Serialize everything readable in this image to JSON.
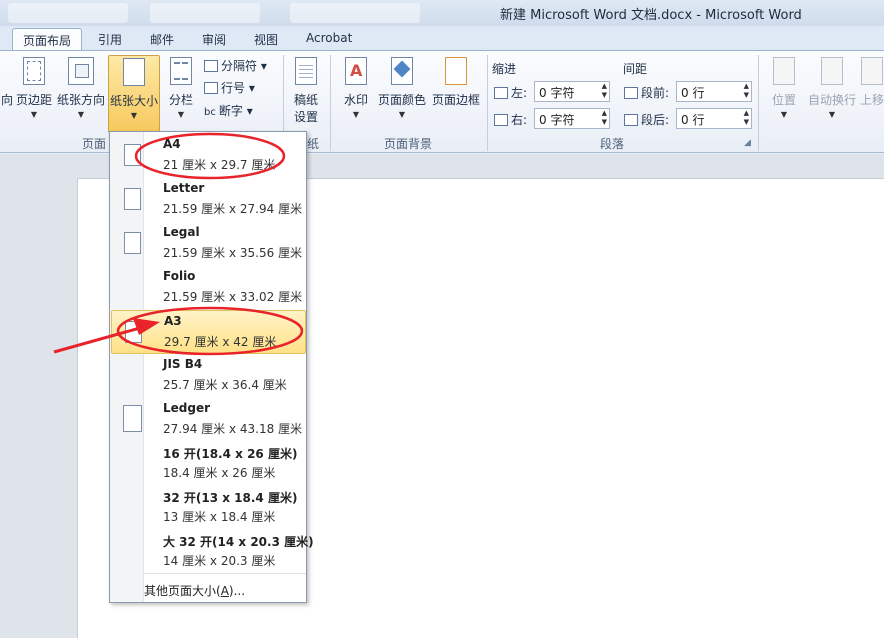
{
  "window": {
    "title": "新建 Microsoft Word 文档.docx - Microsoft Word"
  },
  "tabs": [
    {
      "label": "页面布局",
      "active": true
    },
    {
      "label": "引用"
    },
    {
      "label": "邮件"
    },
    {
      "label": "审阅"
    },
    {
      "label": "视图"
    },
    {
      "label": "Acrobat"
    }
  ],
  "ribbon": {
    "page_setup": {
      "cut_label": "向",
      "margins": "页边距",
      "orientation": "纸张方向",
      "size": "纸张大小",
      "columns": "分栏",
      "breaks": "分隔符",
      "line_numbers": "行号",
      "hyphenation": "断字",
      "group_label": "页面"
    },
    "draft": {
      "line1": "稿纸",
      "line2": "设置",
      "group_cut": "纸"
    },
    "background": {
      "watermark": "水印",
      "page_color": "页面颜色",
      "page_borders": "页面边框",
      "group_label": "页面背景"
    },
    "paragraph": {
      "indent_title": "缩进",
      "spacing_title": "间距",
      "left_label": "左:",
      "right_label": "右:",
      "left_value": "0 字符",
      "right_value": "0 字符",
      "before_label": "段前:",
      "after_label": "段后:",
      "before_value": "0 行",
      "after_value": "0 行",
      "group_label": "段落"
    },
    "arrange": {
      "position": "位置",
      "wrap": "自动换行",
      "forward": "上移"
    }
  },
  "paper_sizes": [
    {
      "name": "A4",
      "dims": "21 厘米 x 29.7 厘米"
    },
    {
      "name": "Letter",
      "dims": "21.59 厘米 x 27.94 厘米"
    },
    {
      "name": "Legal",
      "dims": "21.59 厘米 x 35.56 厘米"
    },
    {
      "name": "Folio",
      "dims": "21.59 厘米 x 33.02 厘米"
    },
    {
      "name": "A3",
      "dims": "29.7 厘米 x 42 厘米",
      "highlighted": true
    },
    {
      "name": "JIS B4",
      "dims": "25.7 厘米 x 36.4 厘米"
    },
    {
      "name": "Ledger",
      "dims": "27.94 厘米 x 43.18 厘米"
    },
    {
      "name": "16 开(18.4 x 26 厘米)",
      "dims": "18.4 厘米 x 26 厘米"
    },
    {
      "name": "32 开(13 x 18.4 厘米)",
      "dims": "13 厘米 x 18.4 厘米"
    },
    {
      "name": "大 32 开(14 x 20.3 厘米)",
      "dims": "14 厘米 x 20.3 厘米"
    }
  ],
  "more_sizes": {
    "text": "其他页面大小(",
    "key": "A",
    "tail": ")..."
  },
  "colors": {
    "annotation_red": "#e8232a",
    "highlight": "#ffe189"
  }
}
